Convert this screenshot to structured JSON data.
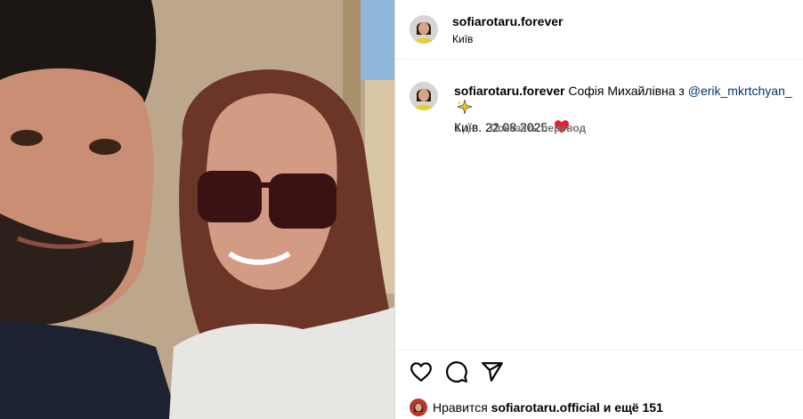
{
  "header": {
    "username": "sofiarotaru.forever",
    "location": "Київ"
  },
  "caption": {
    "username": "sofiarotaru.forever",
    "text_part1": "Софія Михайлівна з",
    "mention": "@erik_mkrtchyan_",
    "text_part2": "Київ. 22.08.2025",
    "emoji_sparkle": "sparkles-icon",
    "emoji_heart": "heart-emoji"
  },
  "meta": {
    "age": "1 дн.",
    "translate_label": "Показать перевод"
  },
  "actions": {
    "like_icon": "heart-outline-icon",
    "comment_icon": "comment-icon",
    "share_icon": "share-icon"
  },
  "likes": {
    "prefix": "Нравится",
    "username": "sofiarotaru.official",
    "suffix": "и ещё 151"
  },
  "colors": {
    "link": "#00376b",
    "secondary": "#737373",
    "divider": "#efefef"
  }
}
